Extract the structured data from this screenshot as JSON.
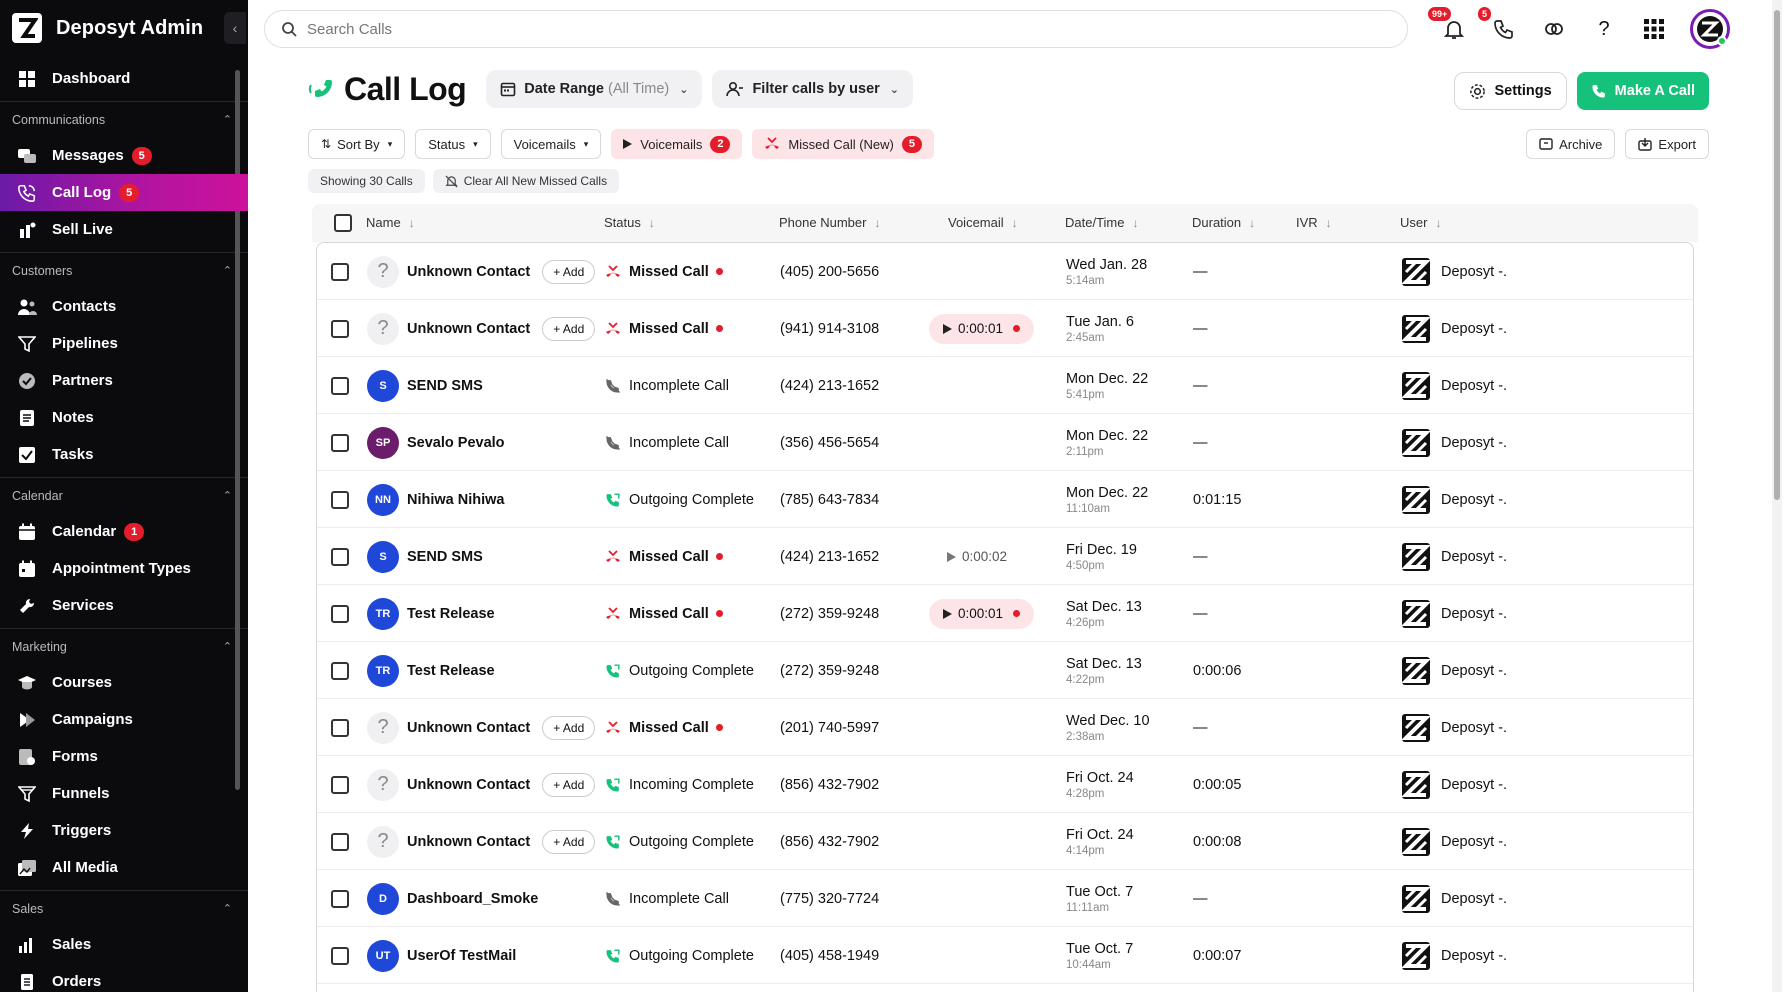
{
  "sidebar": {
    "brand": "Deposyt Admin",
    "dashboard": "Dashboard",
    "sections": [
      {
        "title": "Communications",
        "items": [
          {
            "label": "Messages",
            "badge": "5",
            "icon": "messages-icon"
          },
          {
            "label": "Call Log",
            "badge": "5",
            "icon": "call-log-icon",
            "active": true
          },
          {
            "label": "Sell Live",
            "badge": "",
            "icon": "sell-live-icon"
          }
        ]
      },
      {
        "title": "Customers",
        "items": [
          {
            "label": "Contacts",
            "badge": "",
            "icon": "contacts-icon"
          },
          {
            "label": "Pipelines",
            "badge": "",
            "icon": "pipelines-icon"
          },
          {
            "label": "Partners",
            "badge": "",
            "icon": "partners-icon"
          },
          {
            "label": "Notes",
            "badge": "",
            "icon": "notes-icon"
          },
          {
            "label": "Tasks",
            "badge": "",
            "icon": "tasks-icon"
          }
        ]
      },
      {
        "title": "Calendar",
        "items": [
          {
            "label": "Calendar",
            "badge": "1",
            "icon": "calendar-icon"
          },
          {
            "label": "Appointment Types",
            "badge": "",
            "icon": "appointment-types-icon"
          },
          {
            "label": "Services",
            "badge": "",
            "icon": "services-icon"
          }
        ]
      },
      {
        "title": "Marketing",
        "items": [
          {
            "label": "Courses",
            "badge": "",
            "icon": "courses-icon"
          },
          {
            "label": "Campaigns",
            "badge": "",
            "icon": "campaigns-icon"
          },
          {
            "label": "Forms",
            "badge": "",
            "icon": "forms-icon"
          },
          {
            "label": "Funnels",
            "badge": "",
            "icon": "funnels-icon"
          },
          {
            "label": "Triggers",
            "badge": "",
            "icon": "triggers-icon"
          },
          {
            "label": "All Media",
            "badge": "",
            "icon": "all-media-icon"
          }
        ]
      },
      {
        "title": "Sales",
        "items": [
          {
            "label": "Sales",
            "badge": "",
            "icon": "sales-icon"
          },
          {
            "label": "Orders",
            "badge": "",
            "icon": "orders-icon"
          }
        ]
      }
    ]
  },
  "topbar": {
    "search_placeholder": "Search Calls",
    "notifications_badge": "99+",
    "calls_badge": "5"
  },
  "header": {
    "title": "Call Log",
    "date_range_label": "Date Range",
    "date_range_value": "(All Time)",
    "filter_user_label": "Filter calls by user",
    "settings_label": "Settings",
    "make_call_label": "Make A Call"
  },
  "filters": {
    "sort_by": "Sort By",
    "status": "Status",
    "voicemails": "Voicemails",
    "voicemails_tag": "Voicemails",
    "voicemails_count": "2",
    "missed_tag": "Missed Call (New)",
    "missed_count": "5",
    "archive": "Archive",
    "export": "Export",
    "showing": "Showing 30 Calls",
    "clear_missed": "Clear All New Missed Calls"
  },
  "table": {
    "columns": [
      "Name",
      "Status",
      "Phone Number",
      "Voicemail",
      "Date/Time",
      "Duration",
      "IVR",
      "User"
    ],
    "add_label": "+ Add",
    "rows": [
      {
        "name": "Unknown Contact",
        "initials": "?",
        "avatar": "unknown",
        "status": "Missed Call",
        "status_type": "missed",
        "phone": "(405) 200-5656",
        "voicemail": "",
        "vm_style": "",
        "date": "Wed Jan. 28",
        "time": "5:14am",
        "duration": "—",
        "user": "Deposyt -."
      },
      {
        "name": "Unknown Contact",
        "initials": "?",
        "avatar": "unknown",
        "status": "Missed Call",
        "status_type": "missed",
        "phone": "(941) 914-3108",
        "voicemail": "0:00:01",
        "vm_style": "new",
        "date": "Tue Jan. 6",
        "time": "2:45am",
        "duration": "—",
        "user": "Deposyt -."
      },
      {
        "name": "SEND SMS",
        "initials": "S",
        "avatar": "blue",
        "status": "Incomplete Call",
        "status_type": "incomplete",
        "phone": "(424) 213-1652",
        "voicemail": "",
        "vm_style": "",
        "date": "Mon Dec. 22",
        "time": "5:41pm",
        "duration": "—",
        "user": "Deposyt -."
      },
      {
        "name": "Sevalo Pevalo",
        "initials": "SP",
        "avatar": "purple",
        "status": "Incomplete Call",
        "status_type": "incomplete",
        "phone": "(356) 456-5654",
        "voicemail": "",
        "vm_style": "",
        "date": "Mon Dec. 22",
        "time": "2:11pm",
        "duration": "—",
        "user": "Deposyt -."
      },
      {
        "name": "Nihiwa Nihiwa",
        "initials": "NN",
        "avatar": "blue",
        "status": "Outgoing Complete",
        "status_type": "complete",
        "phone": "(785) 643-7834",
        "voicemail": "",
        "vm_style": "",
        "date": "Mon Dec. 22",
        "time": "11:10am",
        "duration": "0:01:15",
        "user": "Deposyt -."
      },
      {
        "name": "SEND SMS",
        "initials": "S",
        "avatar": "blue",
        "status": "Missed Call",
        "status_type": "missed",
        "phone": "(424) 213-1652",
        "voicemail": "0:00:02",
        "vm_style": "plain",
        "date": "Fri Dec. 19",
        "time": "4:50pm",
        "duration": "—",
        "user": "Deposyt -."
      },
      {
        "name": "Test Release",
        "initials": "TR",
        "avatar": "blue",
        "status": "Missed Call",
        "status_type": "missed",
        "phone": "(272) 359-9248",
        "voicemail": "0:00:01",
        "vm_style": "new",
        "date": "Sat Dec. 13",
        "time": "4:26pm",
        "duration": "—",
        "user": "Deposyt -."
      },
      {
        "name": "Test Release",
        "initials": "TR",
        "avatar": "blue",
        "status": "Outgoing Complete",
        "status_type": "complete",
        "phone": "(272) 359-9248",
        "voicemail": "",
        "vm_style": "",
        "date": "Sat Dec. 13",
        "time": "4:22pm",
        "duration": "0:00:06",
        "user": "Deposyt -."
      },
      {
        "name": "Unknown Contact",
        "initials": "?",
        "avatar": "unknown",
        "status": "Missed Call",
        "status_type": "missed",
        "phone": "(201) 740-5997",
        "voicemail": "",
        "vm_style": "",
        "date": "Wed Dec. 10",
        "time": "2:38am",
        "duration": "—",
        "user": "Deposyt -."
      },
      {
        "name": "Unknown Contact",
        "initials": "?",
        "avatar": "unknown",
        "status": "Incoming Complete",
        "status_type": "complete",
        "phone": "(856) 432-7902",
        "voicemail": "",
        "vm_style": "",
        "date": "Fri Oct. 24",
        "time": "4:28pm",
        "duration": "0:00:05",
        "user": "Deposyt -."
      },
      {
        "name": "Unknown Contact",
        "initials": "?",
        "avatar": "unknown",
        "status": "Outgoing Complete",
        "status_type": "complete",
        "phone": "(856) 432-7902",
        "voicemail": "",
        "vm_style": "",
        "date": "Fri Oct. 24",
        "time": "4:14pm",
        "duration": "0:00:08",
        "user": "Deposyt -."
      },
      {
        "name": "Dashboard_Smoke",
        "initials": "D",
        "avatar": "blue",
        "status": "Incomplete Call",
        "status_type": "incomplete",
        "phone": "(775) 320-7724",
        "voicemail": "",
        "vm_style": "",
        "date": "Tue Oct. 7",
        "time": "11:11am",
        "duration": "—",
        "user": "Deposyt -."
      },
      {
        "name": "UserOf TestMail",
        "initials": "UT",
        "avatar": "blue",
        "status": "Outgoing Complete",
        "status_type": "complete",
        "phone": "(405) 458-1949",
        "voicemail": "",
        "vm_style": "",
        "date": "Tue Oct. 7",
        "time": "10:44am",
        "duration": "0:00:07",
        "user": "Deposyt -."
      }
    ]
  },
  "colors": {
    "accent_green": "#16c27b",
    "missed_red": "#e31d2b",
    "active_gradient_start": "#6b1aa8",
    "active_gradient_end": "#cc129c",
    "avatar_blue": "#1f47d8"
  }
}
